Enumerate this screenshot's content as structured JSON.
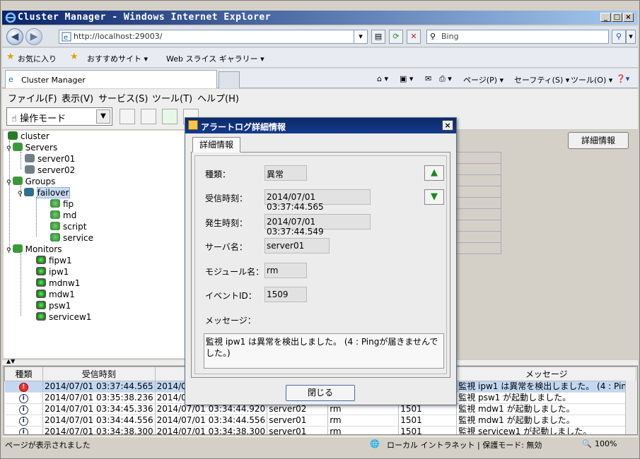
{
  "window": {
    "title": "Cluster Manager - Windows Internet Explorer",
    "min": "_",
    "max": "□",
    "close": "×"
  },
  "browser": {
    "back": "◀",
    "forward": "▶",
    "url": "http://localhost:29003/",
    "search_placeholder": "Bing",
    "favorites": "お気に入り",
    "fav_links": [
      "おすすめサイト ▾",
      "Web スライス ギャラリー ▾"
    ],
    "tab_label": "Cluster Manager",
    "command_bar": [
      "ページ(P) ▾",
      "セーフティ(S) ▾",
      "ツール(O) ▾"
    ]
  },
  "menu": [
    "ファイル(F)",
    "表示(V)",
    "サービス(S)",
    "ツール(T)",
    "ヘルプ(H)"
  ],
  "toolbar": {
    "mode_label": "操作モード",
    "mode_dropdown": "▼"
  },
  "tree": {
    "cluster": "cluster",
    "servers": "Servers",
    "server_items": [
      "server01",
      "server02"
    ],
    "groups": "Groups",
    "group_failover": "failover",
    "resources": [
      "fip",
      "md",
      "script",
      "service"
    ],
    "monitors": "Monitors",
    "monitor_items": [
      "fipw1",
      "ipw1",
      "mdnw1",
      "mdw1",
      "psw1",
      "servicew1"
    ]
  },
  "detail_button": "詳細情報",
  "log": {
    "headers": [
      "種類",
      "受信時刻",
      "",
      "",
      "",
      "",
      "メッセージ"
    ],
    "rows": [
      {
        "type": "error",
        "recv": "2014/07/01 03:37:44.565",
        "occur": "2014/07",
        "server": "",
        "module": "",
        "id": "",
        "msg": "監視 ipw1 は異常を検出しました。 (4 : Pin..."
      },
      {
        "type": "info",
        "recv": "2014/07/01 03:35:38.236",
        "occur": "2014/07",
        "server": "",
        "module": "",
        "id": "",
        "msg": "監視 psw1 が起動しました。"
      },
      {
        "type": "info",
        "recv": "2014/07/01 03:34:45.336",
        "occur": "2014/07/01 03:34:44.920",
        "server": "server02",
        "module": "rm",
        "id": "1501",
        "msg": "監視 mdw1 が起動しました。"
      },
      {
        "type": "info",
        "recv": "2014/07/01 03:34:44.556",
        "occur": "2014/07/01 03:34:44.556",
        "server": "server01",
        "module": "rm",
        "id": "1501",
        "msg": "監視 mdw1 が起動しました。"
      },
      {
        "type": "info",
        "recv": "2014/07/01 03:34:38.300",
        "occur": "2014/07/01 03:34:38.300",
        "server": "server01",
        "module": "rm",
        "id": "1501",
        "msg": "監視 servicew1 が起動しました。"
      }
    ]
  },
  "status": {
    "left": "ページが表示されました",
    "zone": "ローカル イントラネット | 保護モード: 無効",
    "zoom": "100%"
  },
  "dialog": {
    "title": "アラートログ詳細情報",
    "close_x": "×",
    "tab": "詳細情報",
    "fields": {
      "type_label": "種類：",
      "type_value": "異常",
      "recv_label": "受信時刻：",
      "recv_value": "2014/07/01 03:37:44.565",
      "occur_label": "発生時刻：",
      "occur_value": "2014/07/01 03:37:44.549",
      "server_label": "サーバ名：",
      "server_value": "server01",
      "module_label": "モジュール名：",
      "module_value": "rm",
      "event_label": "イベントID：",
      "event_value": "1509",
      "message_label": "メッセージ："
    },
    "message": "監視 ipw1 は異常を検出しました。 (4 : Pingが届きませんでした。)",
    "up": "▲",
    "down": "▼",
    "close_button": "閉じる"
  }
}
